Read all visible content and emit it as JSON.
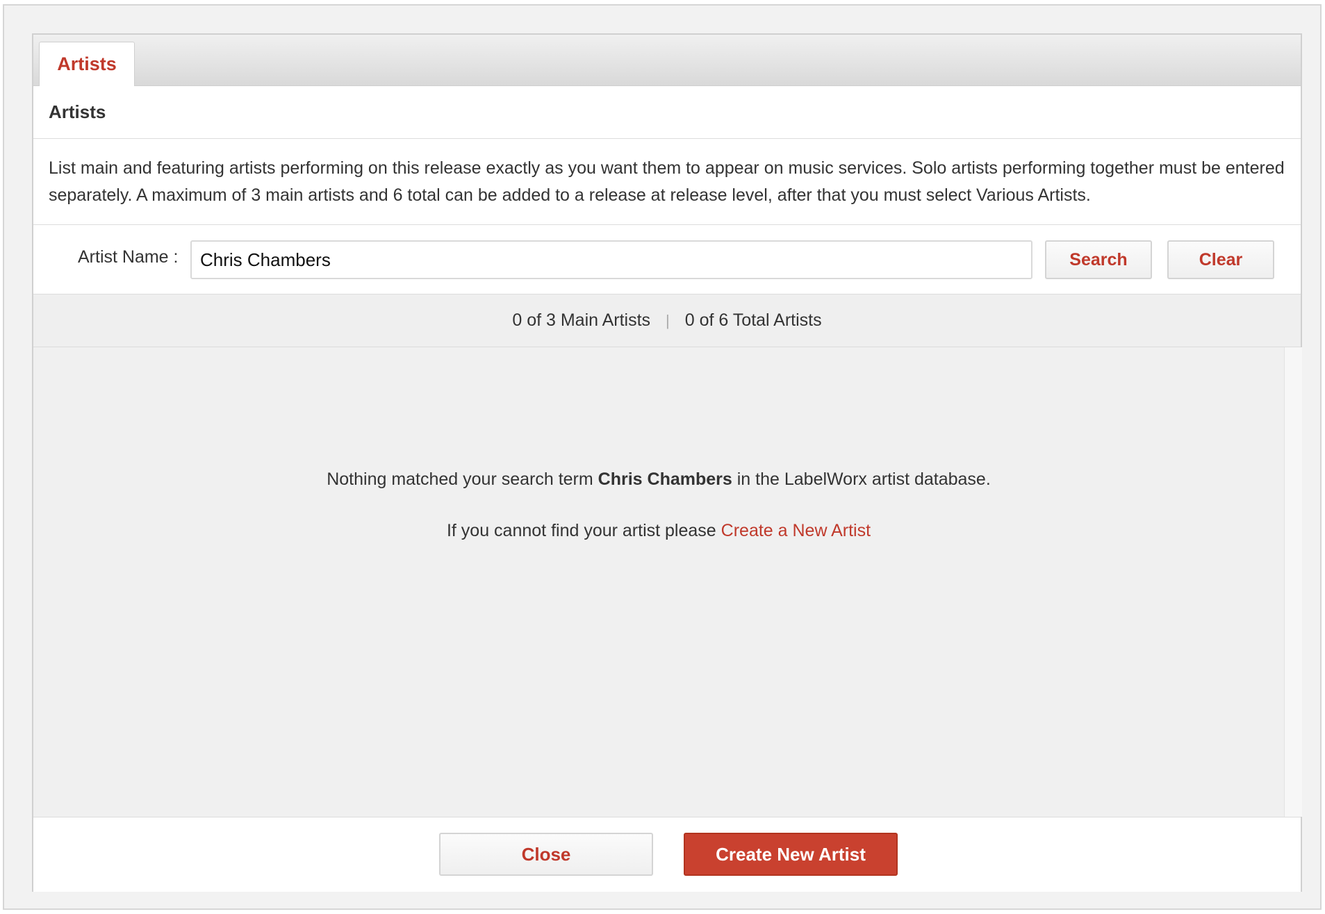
{
  "tabs": [
    {
      "label": "Artists",
      "active": true
    }
  ],
  "section": {
    "title": "Artists"
  },
  "description": "List main and featuring artists performing on this release exactly as you want them to appear on music services. Solo artists performing together must be entered separately. A maximum of 3 main artists and 6 total can be added to a release at release level, after that you must select Various Artists.",
  "search": {
    "label": "Artist Name :",
    "value": "Chris Chambers",
    "search_label": "Search",
    "clear_label": "Clear"
  },
  "counts": {
    "main": "0 of 3 Main Artists",
    "separator": "|",
    "total": "0 of 6 Total Artists"
  },
  "results": {
    "empty_prefix": "Nothing matched your search term",
    "empty_term": "Chris Chambers",
    "empty_suffix": "in the LabelWorx artist database.",
    "help_prefix": "If you cannot find your artist please",
    "help_link": "Create a New Artist"
  },
  "footer": {
    "close_label": "Close",
    "create_label": "Create New Artist"
  },
  "colors": {
    "accent": "#c0392b",
    "primary_button": "#c9412f",
    "panel_bg": "#f0f0f0"
  }
}
